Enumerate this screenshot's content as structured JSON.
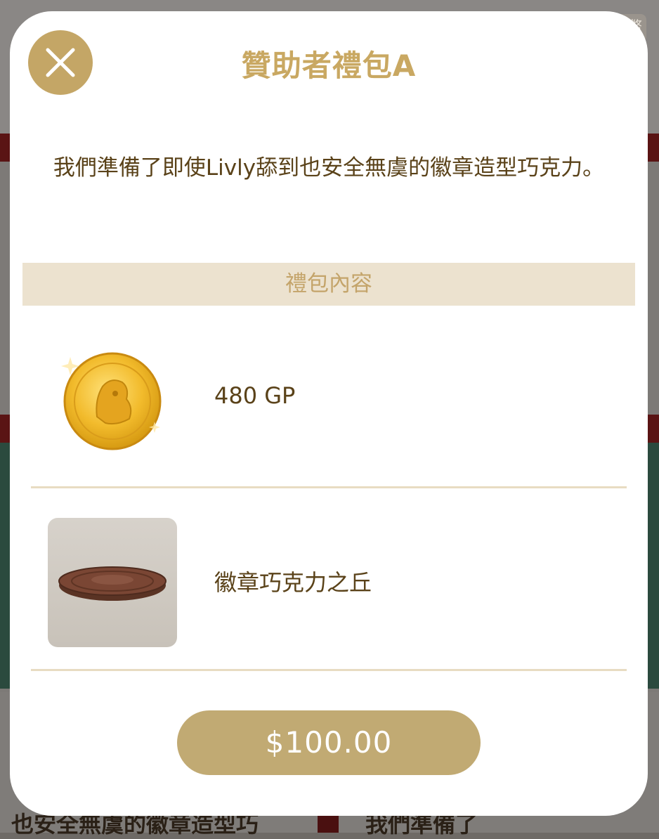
{
  "modal": {
    "title": "贊助者禮包A",
    "description": "我們準備了即使Livly舔到也安全無虞的徽章造型巧克力。",
    "section_header": "禮包內容",
    "items": [
      {
        "label": "480 GP",
        "icon": "gold-coin-icon"
      },
      {
        "label": "徽章巧克力之丘",
        "icon": "chocolate-badge-icon"
      }
    ],
    "price": "$100.00",
    "close_icon": "close-icon"
  },
  "background": {
    "text_left": "也安全無虞的徽章造型巧",
    "text_right": "我們準備了",
    "top_badge": "幣"
  },
  "colors": {
    "accent_gold": "#c4a666",
    "title_gold": "#c9a862",
    "text_brown": "#5a4219",
    "section_bg": "#ece2cf",
    "price_button": "#c1aa73"
  }
}
